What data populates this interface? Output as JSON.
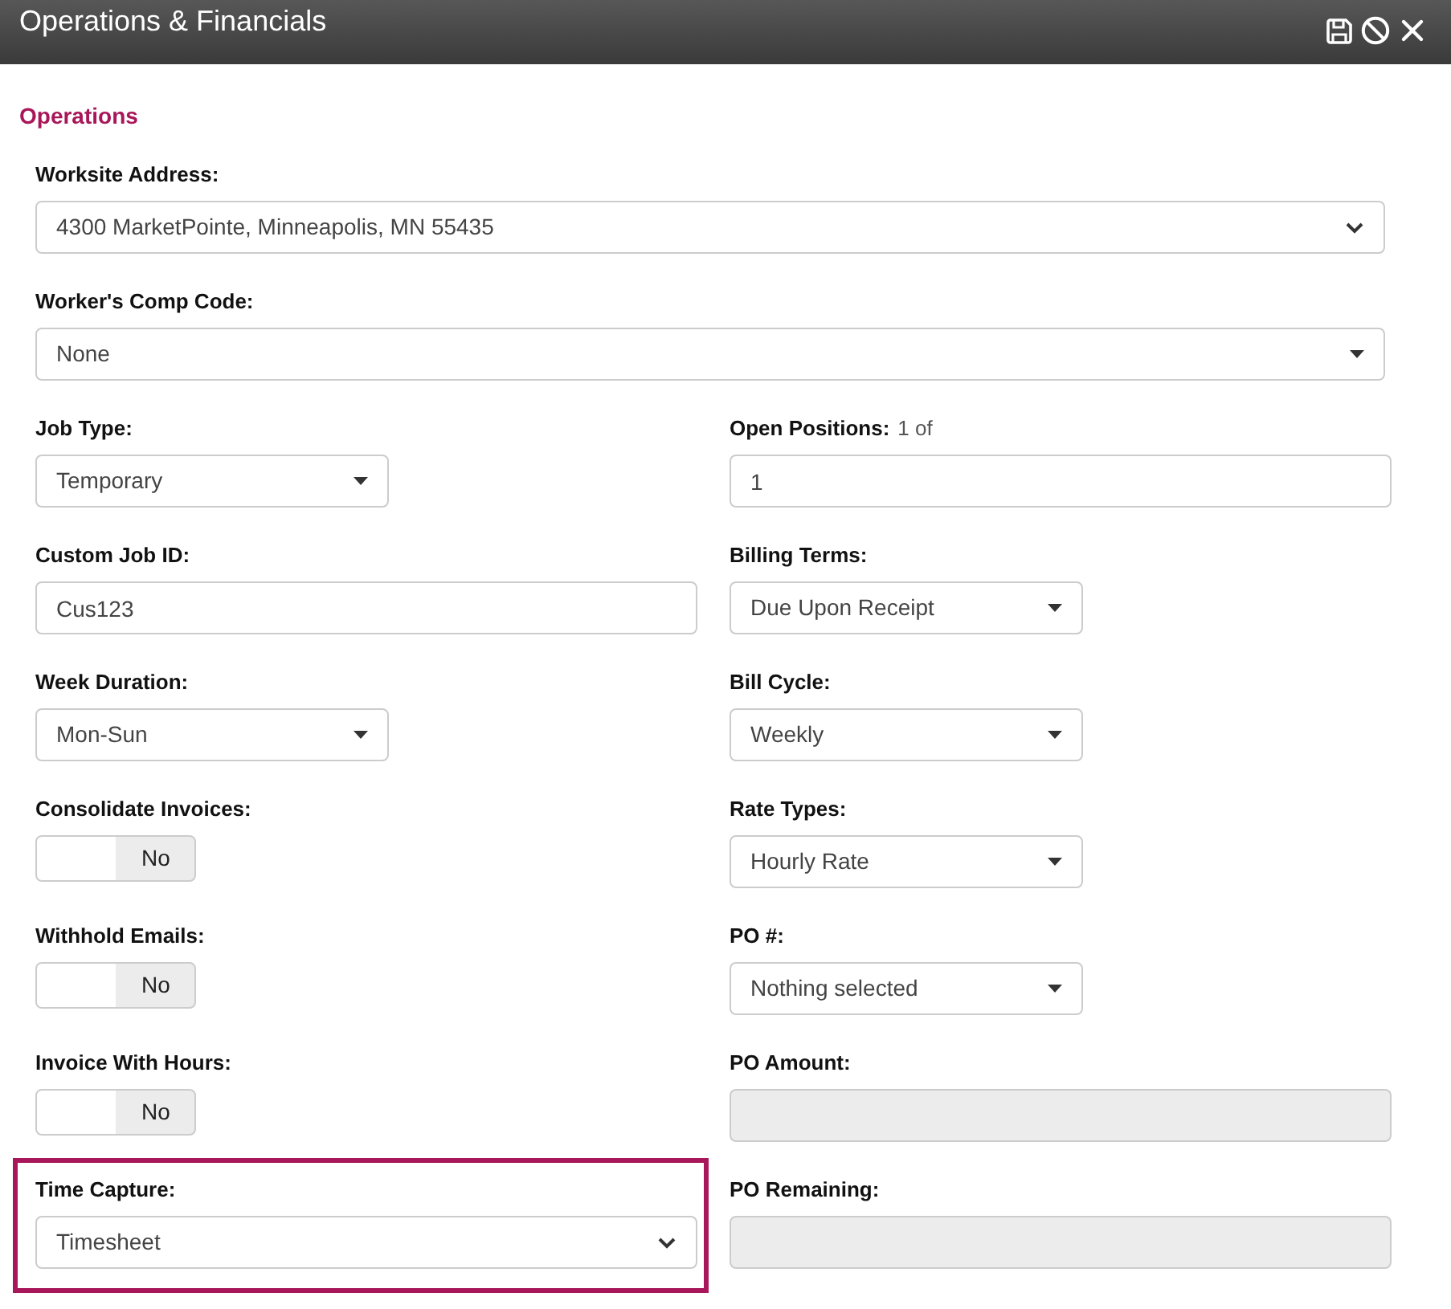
{
  "window": {
    "title": "Operations & Financials"
  },
  "section": {
    "title": "Operations"
  },
  "rows": [
    [
      {
        "label": "Worksite Address:",
        "kind": "select",
        "value": "4300 MarketPointe, Minneapolis, MN 55435",
        "highlighted": false
      }
    ],
    [
      {
        "label": "Worker's Comp Code:",
        "kind": "dropdown",
        "value": "None",
        "highlighted": false
      }
    ],
    [
      {
        "label": "Job Type:",
        "kind": "dropdown",
        "value": "Temporary",
        "highlighted": false
      },
      {
        "label": "Open Positions:",
        "note": "1 of",
        "kind": "input",
        "value": "1",
        "disabled": false,
        "highlighted": false
      }
    ],
    [
      {
        "label": "Custom Job ID:",
        "kind": "input",
        "value": "Cus123",
        "disabled": false,
        "highlighted": false
      },
      {
        "label": "Billing Terms:",
        "kind": "dropdown",
        "value": "Due Upon Receipt",
        "highlighted": false
      }
    ],
    [
      {
        "label": "Week Duration:",
        "kind": "dropdown",
        "value": "Mon-Sun",
        "highlighted": false
      },
      {
        "label": "Bill Cycle:",
        "kind": "dropdown",
        "value": "Weekly",
        "highlighted": false
      }
    ],
    [
      {
        "label": "Consolidate Invoices:",
        "kind": "toggle",
        "on": false,
        "text": "No",
        "highlighted": false
      },
      {
        "label": "Rate Types:",
        "kind": "dropdown",
        "value": "Hourly Rate",
        "highlighted": false
      }
    ],
    [
      {
        "label": "Withhold Emails:",
        "kind": "toggle",
        "on": false,
        "text": "No",
        "highlighted": false
      },
      {
        "label": "PO #:",
        "kind": "dropdown",
        "value": "Nothing selected",
        "highlighted": false
      }
    ],
    [
      {
        "label": "Invoice With Hours:",
        "kind": "toggle",
        "on": false,
        "text": "No",
        "highlighted": false
      },
      {
        "label": "PO Amount:",
        "kind": "input",
        "disabled": true,
        "highlighted": false
      }
    ],
    [
      {
        "label": "Time Capture:",
        "kind": "select",
        "value": "Timesheet",
        "highlighted": true
      },
      {
        "label": "PO Remaining:",
        "kind": "input",
        "disabled": true,
        "highlighted": false
      }
    ]
  ]
}
